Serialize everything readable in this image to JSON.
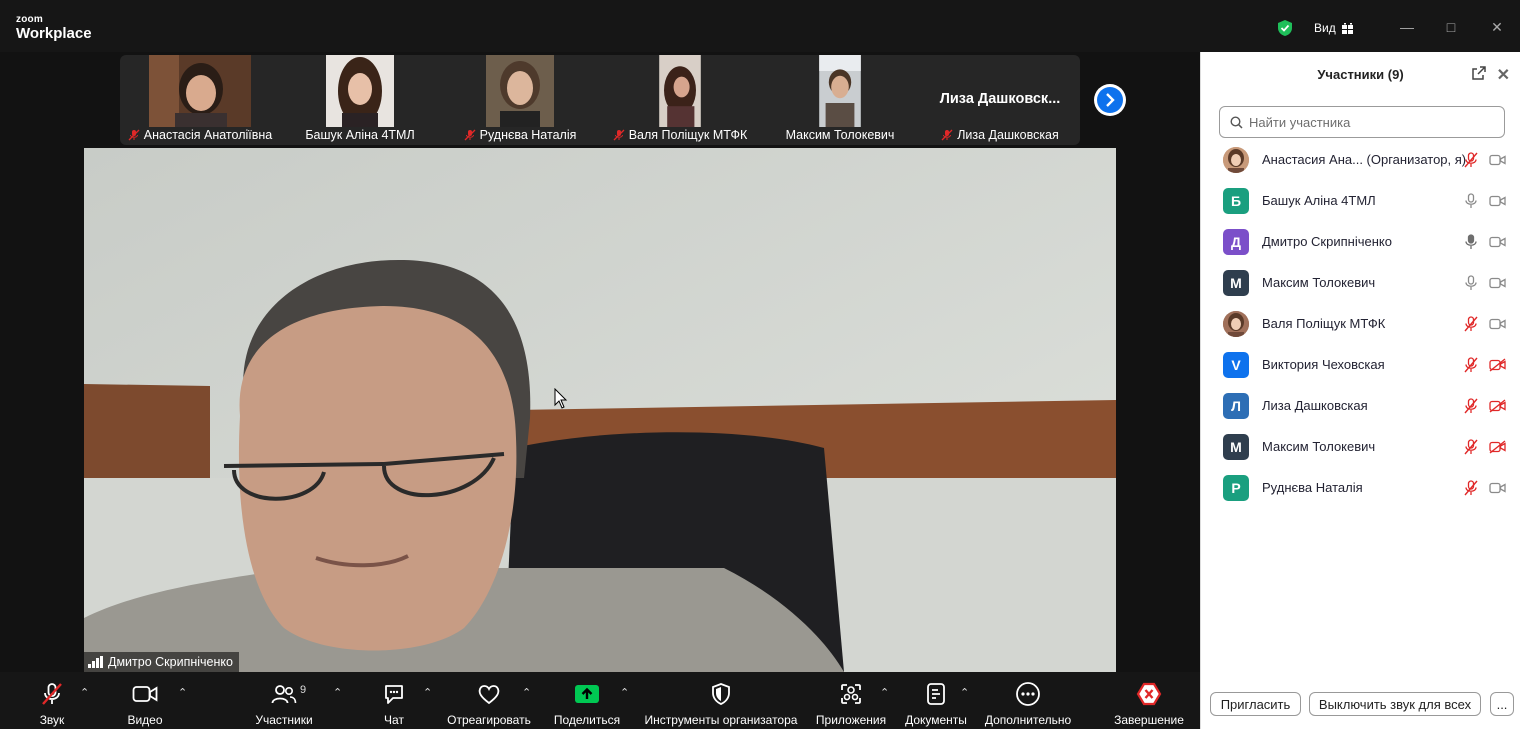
{
  "window": {
    "brand_small": "zoom",
    "brand_large": "Workplace",
    "view_label": "Вид"
  },
  "gallery": {
    "tiles": [
      {
        "name": "Анастасія Анатоліївна",
        "muted": true
      },
      {
        "name": "Башук Аліна 4ТМЛ",
        "muted": false
      },
      {
        "name": "Руднєва Наталія",
        "muted": true
      },
      {
        "name": "Валя Поліщук МТФК",
        "muted": true
      },
      {
        "name": "Максим Толокевич",
        "muted": false
      },
      {
        "name": "Лиза Дашковская",
        "muted": true,
        "big_name": "Лиза  Дашковск..."
      }
    ]
  },
  "main_video": {
    "speaker_name": "Дмитро Скрипніченко"
  },
  "toolbar": {
    "audio": "Звук",
    "video": "Видео",
    "participants": "Участники",
    "participants_count": "9",
    "chat": "Чат",
    "react": "Отреагировать",
    "share": "Поделиться",
    "host_tools": "Инструменты организатора",
    "apps": "Приложения",
    "docs": "Документы",
    "more": "Дополнительно",
    "end": "Завершение"
  },
  "sidebar": {
    "title": "Участники (9)",
    "search_placeholder": "Найти участника",
    "participants": [
      {
        "name": "Анастасия Ана...  (Организатор, я)",
        "avatar": "",
        "avatar_color": "#c89a7a",
        "photo": true,
        "mic": "muted",
        "cam": "on"
      },
      {
        "name": "Башук Аліна 4ТМЛ",
        "avatar": "Б",
        "avatar_color": "#1a9f7f",
        "photo": false,
        "mic": "on",
        "cam": "on"
      },
      {
        "name": "Дмитро Скрипніченко",
        "avatar": "Д",
        "avatar_color": "#7b4fc9",
        "photo": false,
        "mic": "active",
        "cam": "on"
      },
      {
        "name": "Максим Толокевич",
        "avatar": "М",
        "avatar_color": "#2f3e4e",
        "photo": false,
        "mic": "on",
        "cam": "on"
      },
      {
        "name": "Валя Поліщук МТФК",
        "avatar": "",
        "avatar_color": "#a0705a",
        "photo": true,
        "mic": "muted",
        "cam": "on"
      },
      {
        "name": "Виктория Чеховская",
        "avatar": "V",
        "avatar_color": "#0e72ed",
        "photo": false,
        "mic": "muted",
        "cam": "off"
      },
      {
        "name": "Лиза Дашковская",
        "avatar": "Л",
        "avatar_color": "#2d6eb5",
        "photo": false,
        "mic": "muted",
        "cam": "off"
      },
      {
        "name": "Максим Толокевич",
        "avatar": "М",
        "avatar_color": "#2f3e4e",
        "photo": false,
        "mic": "muted",
        "cam": "off"
      },
      {
        "name": "Руднєва Наталія",
        "avatar": "Р",
        "avatar_color": "#1a9f7f",
        "photo": false,
        "mic": "muted",
        "cam": "on"
      }
    ],
    "invite": "Пригласить",
    "mute_all": "Выключить звук для всех",
    "more": "..."
  },
  "colors": {
    "accent": "#0e72ed",
    "muted_red": "#e02828",
    "share_green": "#00c853",
    "shield_green": "#1fbf5a"
  }
}
